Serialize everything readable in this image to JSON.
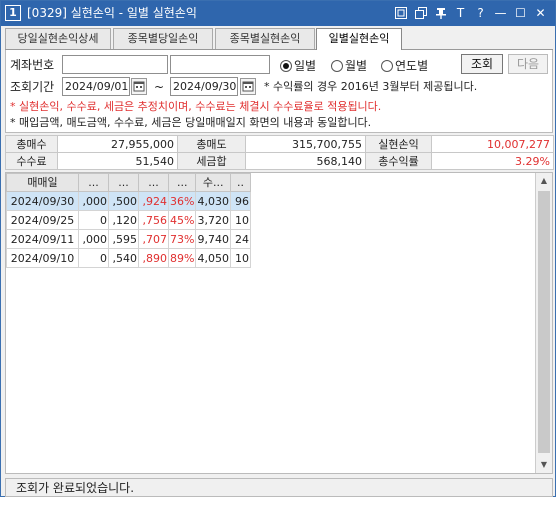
{
  "window": {
    "number": "1",
    "title": "[0329] 실현손익 - 일별 실현손익"
  },
  "titlebar_buttons": [
    {
      "icon": "link-icon"
    },
    {
      "icon": "window-icon"
    },
    {
      "icon": "pin-icon"
    },
    {
      "label": "T"
    },
    {
      "label": "?"
    },
    {
      "label": "—"
    },
    {
      "label": "☐"
    },
    {
      "label": "✕"
    }
  ],
  "tabs": [
    {
      "label": "당일실현손익상세",
      "active": false
    },
    {
      "label": "종목별당일손익",
      "active": false
    },
    {
      "label": "종목별실현손익",
      "active": false
    },
    {
      "label": "일별실현손익",
      "active": true
    }
  ],
  "form": {
    "account_label": "계좌번호",
    "account_value": "",
    "account_name_value": "",
    "radios": [
      {
        "label": "일별",
        "checked": true
      },
      {
        "label": "월별",
        "checked": false
      },
      {
        "label": "연도별",
        "checked": false
      }
    ],
    "query_button": "조회",
    "next_button": "다음",
    "period_label": "조회기간",
    "start_date": "2024/09/01",
    "tilde": "~",
    "end_date": "2024/09/30",
    "period_note": "* 수익률의 경우 2016년 3월부터 제공됩니다.",
    "note_red": "* 실현손익, 수수료, 세금은 추정치이며, 수수료는 체결시 수수료율로 적용됩니다.",
    "note_dark": "* 매입금액, 매도금액, 수수료, 세금은 당일매매일지 화면의 내용과 동일합니다."
  },
  "summary": {
    "row1": [
      {
        "label": "총매수",
        "value": "27,955,000"
      },
      {
        "label": "총매도",
        "value": "315,700,755"
      },
      {
        "label": "실현손익",
        "value": "10,007,277",
        "red": true
      }
    ],
    "row2": [
      {
        "label": "수수료",
        "value": "51,540"
      },
      {
        "label": "세금합",
        "value": "568,140"
      },
      {
        "label": "총수익률",
        "value": "3.29%",
        "red": true
      }
    ]
  },
  "grid": {
    "headers": [
      "매매일",
      "...",
      "...",
      "...",
      "...",
      "수...",
      ".."
    ],
    "rows": [
      {
        "cells": [
          "2024/09/30",
          ",000",
          ",500",
          ",924",
          "36%",
          "4,030",
          "96"
        ],
        "selected": true
      },
      {
        "cells": [
          "2024/09/25",
          "0",
          ",120",
          ",756",
          "45%",
          "3,720",
          "10"
        ],
        "selected": false
      },
      {
        "cells": [
          "2024/09/11",
          ",000",
          ",595",
          ",707",
          "73%",
          "9,740",
          "24"
        ],
        "selected": false
      },
      {
        "cells": [
          "2024/09/10",
          "0",
          ",540",
          ",890",
          "89%",
          "4,050",
          "10"
        ],
        "selected": false
      }
    ],
    "red_columns": [
      3,
      4
    ]
  },
  "status": {
    "text": "조회가 완료되었습니다."
  },
  "colors": {
    "titlebar": "#2f66ad",
    "profit_red": "#e03030",
    "selected_row": "#cfe4f6"
  }
}
